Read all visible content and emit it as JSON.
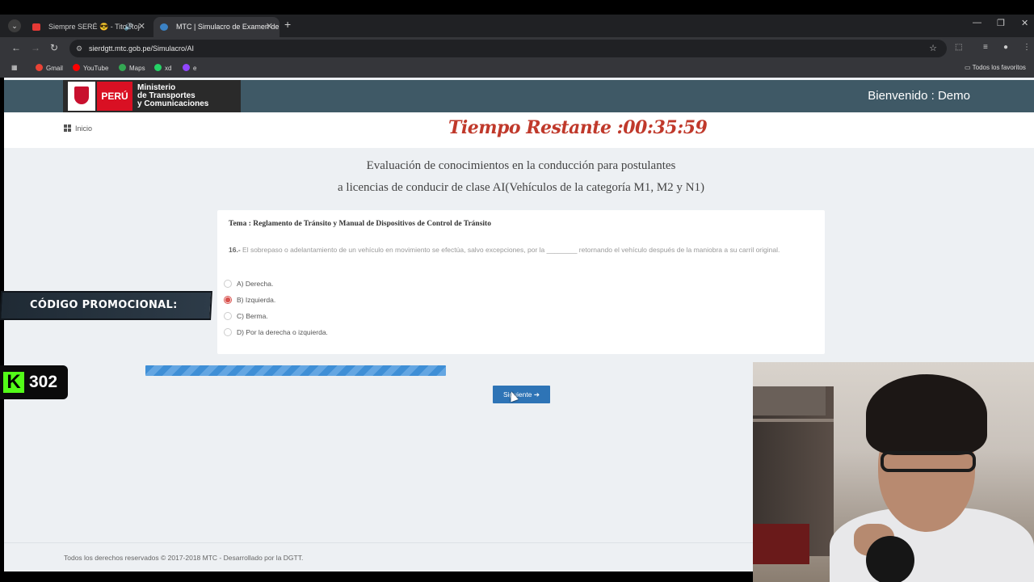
{
  "browser": {
    "tabs": [
      {
        "title": "Siempre SERÉ 😎 - Tito Roj",
        "active": false
      },
      {
        "title": "MTC | Simulacro de Examen de",
        "active": true
      }
    ],
    "url": "sierdgtt.mtc.gob.pe/Simulacro/AI",
    "bookmarks": [
      "Gmail",
      "YouTube",
      "Maps",
      "xd",
      "e"
    ],
    "all_bookmarks": "Todos los favoritos"
  },
  "header": {
    "logo_country": "PERÚ",
    "logo_line1": "Ministerio",
    "logo_line2": "de Transportes",
    "logo_line3": "y Comunicaciones",
    "welcome": "Bienvenido : Demo"
  },
  "nav": {
    "home": "Inicio",
    "timer": "Tiempo Restante :00:35:59"
  },
  "exam": {
    "title_line1": "Evaluación de conocimientos en la conducción para postulantes",
    "title_line2": "a licencias de conducir de clase AI(Vehículos de la categoría M1, M2 y N1)",
    "topic": "Tema : Reglamento de Tránsito y Manual de Dispositivos de Control de Tránsito",
    "question_number": "16.-",
    "question_text": "El sobrepaso o adelantamiento de un vehículo en movimiento se efectúa, salvo excepciones, por la ________ retornando el vehículo después de la maniobra a su carril original.",
    "options": [
      {
        "label": "A) Derecha.",
        "selected": false
      },
      {
        "label": "B) Izquierda.",
        "selected": true
      },
      {
        "label": "C) Berma.",
        "selected": false
      },
      {
        "label": "D) Por la derecha o izquierda.",
        "selected": false
      }
    ],
    "next_label": "Siguiente",
    "next_icon": "arrow-right-icon"
  },
  "footer": {
    "text": "Todos los derechos reservados © 2017-2018 MTC - Desarrollado por la DGTT."
  },
  "overlay": {
    "promo": "CÓDIGO PROMOCIONAL:",
    "viewer_count": "302",
    "kick_brand": "K"
  },
  "colors": {
    "header_bg": "#3f5966",
    "timer": "#c0392b",
    "button": "#2e74b6",
    "peru_red": "#d91023",
    "kick_green": "#53fc18"
  }
}
